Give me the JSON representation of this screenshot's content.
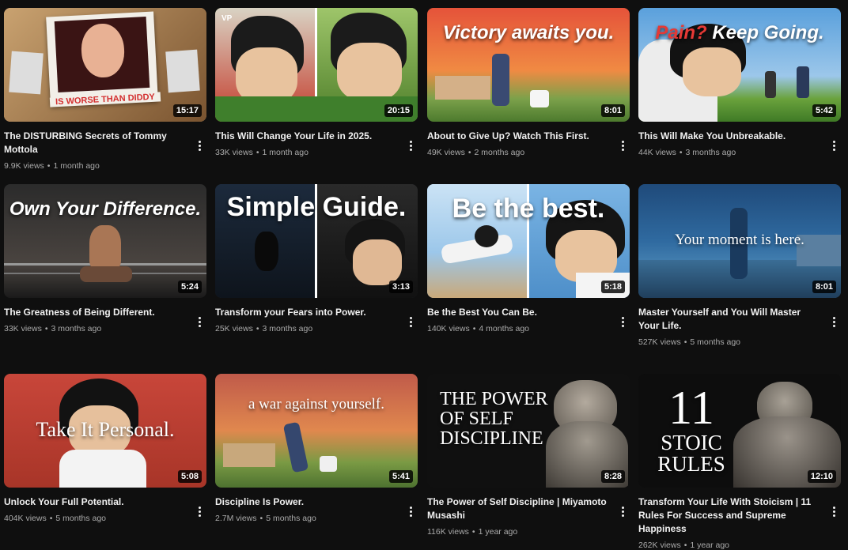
{
  "videos": [
    {
      "title": "The DISTURBING Secrets of Tommy Mottola",
      "views": "9.9K views",
      "age": "1 month ago",
      "duration": "15:17",
      "overlay": "IS WORSE THAN DIDDY"
    },
    {
      "title": "This Will Change Your Life in 2025.",
      "views": "33K views",
      "age": "1 month ago",
      "duration": "20:15",
      "overlay": ""
    },
    {
      "title": "About to Give Up? Watch This First.",
      "views": "49K views",
      "age": "2 months ago",
      "duration": "8:01",
      "overlay": "Victory awaits you."
    },
    {
      "title": "This Will Make You Unbreakable.",
      "views": "44K views",
      "age": "3 months ago",
      "duration": "5:42",
      "overlay": "Pain? Keep Going.",
      "overlay_a": "Pain?",
      "overlay_b": "Keep Going."
    },
    {
      "title": "The Greatness of Being Different.",
      "views": "33K views",
      "age": "3 months ago",
      "duration": "5:24",
      "overlay": "Own Your Difference."
    },
    {
      "title": "Transform your Fears into Power.",
      "views": "25K views",
      "age": "3 months ago",
      "duration": "3:13",
      "overlay": "Simple Guide."
    },
    {
      "title": "Be the Best You Can Be.",
      "views": "140K views",
      "age": "4 months ago",
      "duration": "5:18",
      "overlay": "Be the best."
    },
    {
      "title": "Master Yourself and You Will Master Your Life.",
      "views": "527K views",
      "age": "5 months ago",
      "duration": "8:01",
      "overlay": "Your moment is here."
    },
    {
      "title": "Unlock Your Full Potential.",
      "views": "404K views",
      "age": "5 months ago",
      "duration": "5:08",
      "overlay": "Take It Personal."
    },
    {
      "title": "Discipline Is Power.",
      "views": "2.7M views",
      "age": "5 months ago",
      "duration": "5:41",
      "overlay": "a war against yourself."
    },
    {
      "title": "The Power of Self Discipline | Miyamoto Musashi",
      "views": "116K views",
      "age": "1 year ago",
      "duration": "8:28",
      "overlay_lines": [
        "THE POWER",
        "OF SELF",
        "DISCIPLINE"
      ]
    },
    {
      "title": "Transform Your Life With Stoicism | 11 Rules For Success and Supreme Happiness",
      "views": "262K views",
      "age": "1 year ago",
      "duration": "12:10",
      "overlay_lines": [
        "11",
        "STOIC",
        "RULES"
      ]
    }
  ],
  "colors": {
    "background": "#0f0f0f",
    "title": "#f1f1f1",
    "meta": "#aaaaaa",
    "accent_red": "#e53935"
  },
  "icons": {
    "more": "more-vert-icon"
  }
}
